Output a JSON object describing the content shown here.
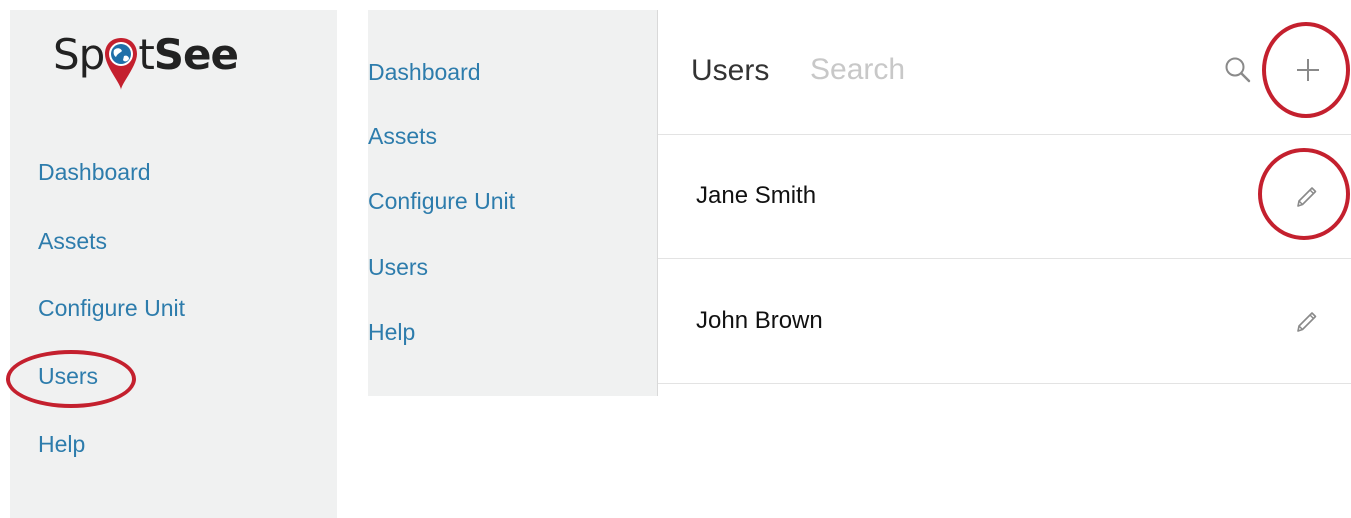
{
  "logo": {
    "text_light": "Sp",
    "text_mid": "t",
    "text_bold": "See",
    "pin_color": "#c4202e",
    "globe_color": "#1f6fa8"
  },
  "left_nav": {
    "items": [
      {
        "label": "Dashboard"
      },
      {
        "label": "Assets"
      },
      {
        "label": "Configure Unit"
      },
      {
        "label": "Users"
      },
      {
        "label": "Help"
      }
    ]
  },
  "secondary_nav": {
    "items": [
      {
        "label": "Dashboard"
      },
      {
        "label": "Assets"
      },
      {
        "label": "Configure Unit"
      },
      {
        "label": "Users"
      },
      {
        "label": "Help"
      }
    ]
  },
  "users_panel": {
    "title": "Users",
    "search_placeholder": "Search",
    "search_icon": "search-icon",
    "add_icon": "plus-icon",
    "edit_icon": "pencil-icon",
    "rows": [
      {
        "name": "Jane Smith"
      },
      {
        "name": "John Brown"
      }
    ]
  },
  "colors": {
    "link": "#2d7cac",
    "sidebar_bg": "#f0f1f1",
    "highlight": "#c4202e",
    "icon": "#8a8a8a"
  }
}
